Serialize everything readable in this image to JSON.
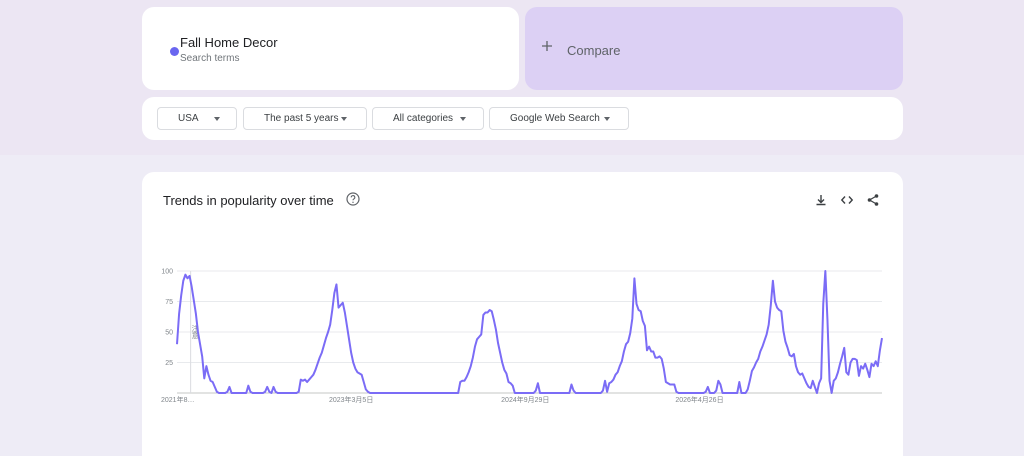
{
  "search": {
    "term": "Fall Home Decor",
    "term_sub": "Search terms",
    "term_color": "#6a66f0",
    "compare_label": "Compare",
    "compare_icon": "plus-icon"
  },
  "filters": {
    "region": "USA",
    "time": "The past 5 years",
    "category": "All categories",
    "property": "Google Web Search"
  },
  "trends": {
    "title": "Trends in popularity over time",
    "help_icon": "help-circle-icon",
    "download_icon": "download-icon",
    "embed_icon": "embed-code-icon",
    "share_icon": "share-icon",
    "note_label": "注意"
  },
  "chart_data": {
    "type": "line",
    "title": "Trends in popularity over time",
    "xlabel": "",
    "ylabel": "",
    "ylim": [
      0,
      100
    ],
    "grid": true,
    "yticks": [
      "100",
      "75",
      "50",
      "25"
    ],
    "ytick_values": [
      100,
      75,
      50,
      25
    ],
    "x_tick_labels": [
      "2021年8…",
      "2023年3月5日",
      "2024年9月29日",
      "2026年4月26日"
    ],
    "x_tick_index": [
      0,
      83,
      166,
      249
    ],
    "line_color": "#7b6cf6",
    "series": [
      {
        "name": "Fall Home Decor",
        "values": [
          40,
          65,
          80,
          92,
          97,
          94,
          96,
          87,
          76,
          65,
          50,
          40,
          30,
          12,
          22,
          15,
          10,
          9,
          5,
          1,
          0,
          0,
          0,
          0,
          1,
          5,
          0,
          0,
          0,
          0,
          0,
          0,
          0,
          0,
          6,
          1,
          0,
          0,
          0,
          0,
          0,
          0,
          1,
          5,
          1,
          0,
          5,
          1,
          0,
          0,
          0,
          0,
          0,
          0,
          0,
          0,
          0,
          0,
          1,
          11,
          10,
          11,
          9,
          11,
          13,
          15,
          19,
          24,
          29,
          33,
          39,
          45,
          50,
          56,
          68,
          82,
          89,
          70,
          72,
          74,
          66,
          55,
          44,
          33,
          25,
          20,
          17,
          16,
          15,
          9,
          3,
          1,
          0,
          0,
          0,
          0,
          0,
          0,
          0,
          0,
          0,
          0,
          0,
          0,
          0,
          0,
          0,
          0,
          0,
          0,
          0,
          0,
          0,
          0,
          0,
          0,
          0,
          0,
          0,
          0,
          0,
          0,
          0,
          0,
          0,
          0,
          0,
          0,
          0,
          0,
          0,
          0,
          0,
          0,
          0,
          9,
          10,
          10,
          13,
          17,
          22,
          29,
          38,
          44,
          46,
          48,
          64,
          66,
          66,
          68,
          67,
          60,
          52,
          41,
          33,
          25,
          19,
          16,
          9,
          8,
          6,
          0,
          0,
          0,
          0,
          0,
          0,
          0,
          0,
          0,
          0,
          2,
          8,
          0,
          0,
          0,
          0,
          0,
          0,
          0,
          0,
          0,
          0,
          0,
          0,
          0,
          0,
          0,
          7,
          2,
          0,
          0,
          0,
          0,
          0,
          0,
          0,
          0,
          0,
          0,
          0,
          0,
          0,
          2,
          10,
          1,
          8,
          9,
          11,
          15,
          17,
          22,
          26,
          34,
          40,
          42,
          49,
          61,
          94,
          73,
          68,
          67,
          59,
          55,
          35,
          38,
          34,
          34,
          29,
          29,
          30,
          28,
          20,
          9,
          8,
          7,
          7,
          7,
          1,
          0,
          0,
          0,
          0,
          0,
          0,
          0,
          0,
          0,
          0,
          0,
          0,
          0,
          1,
          5,
          0,
          0,
          0,
          2,
          10,
          7,
          0,
          0,
          0,
          0,
          0,
          0,
          0,
          0,
          9,
          0,
          0,
          0,
          3,
          10,
          18,
          21,
          25,
          28,
          34,
          38,
          43,
          48,
          56,
          72,
          92,
          75,
          70,
          68,
          67,
          51,
          42,
          37,
          31,
          30,
          32,
          22,
          17,
          15,
          16,
          12,
          8,
          5,
          4,
          10,
          5,
          0,
          8,
          12,
          73,
          100,
          60,
          10,
          0,
          10,
          12,
          17,
          24,
          30,
          37,
          17,
          15,
          25,
          28,
          28,
          27,
          14,
          22,
          20,
          24,
          19,
          13,
          24,
          22,
          26,
          22,
          35,
          45
        ]
      }
    ]
  }
}
